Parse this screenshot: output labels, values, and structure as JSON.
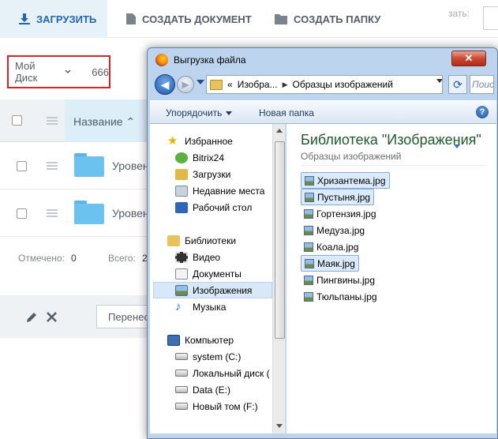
{
  "app": {
    "toolbar": {
      "upload_label": "ЗАГРУЗИТЬ",
      "create_doc_label": "СОЗДАТЬ ДОКУМЕНТ",
      "create_folder_label": "СОЗДАТЬ ПАПКУ",
      "search_label": "зать:"
    },
    "disk": {
      "label": "Мой Диск",
      "count": "666"
    },
    "grid": {
      "column_name": "Название",
      "rows": [
        {
          "name": "Уровен"
        },
        {
          "name": "Уровен"
        }
      ]
    },
    "summary": {
      "checked_label": "Отмечено:",
      "checked_value": "0",
      "total_label": "Всего:",
      "total_value": "2"
    },
    "actions": {
      "move_label": "Перенести"
    }
  },
  "dialog": {
    "title": "Выгрузка файла",
    "close_label": "✕",
    "address": {
      "prefix": "«",
      "part1": "Изобра...",
      "part2": "Образцы изображений"
    },
    "search_placeholder": "Поиск",
    "commands": {
      "organize": "Упорядочить",
      "new_folder": "Новая папка"
    },
    "nav": {
      "favorites": "Избранное",
      "bitrix": "Bitrix24",
      "downloads": "Загрузки",
      "recent": "Недавние места",
      "desktop": "Рабочий стол",
      "libraries": "Библиотеки",
      "video": "Видео",
      "documents": "Документы",
      "images": "Изображения",
      "music": "Музыка",
      "computer": "Компьютер",
      "system": "system (C:)",
      "local": "Локальный диск (",
      "data": "Data (E:)",
      "newvol": "Новый том (F:)"
    },
    "library": {
      "title": "Библиотека \"Изображения\"",
      "subtitle": "Образцы изображений"
    },
    "files": [
      {
        "name": "Хризантема.jpg",
        "selected": true
      },
      {
        "name": "Пустыня.jpg",
        "selected": true
      },
      {
        "name": "Гортензия.jpg",
        "selected": false
      },
      {
        "name": "Медуза.jpg",
        "selected": false
      },
      {
        "name": "Коала.jpg",
        "selected": false
      },
      {
        "name": "Маяк.jpg",
        "selected": true
      },
      {
        "name": "Пингвины.jpg",
        "selected": false
      },
      {
        "name": "Тюльпаны.jpg",
        "selected": false
      }
    ]
  }
}
